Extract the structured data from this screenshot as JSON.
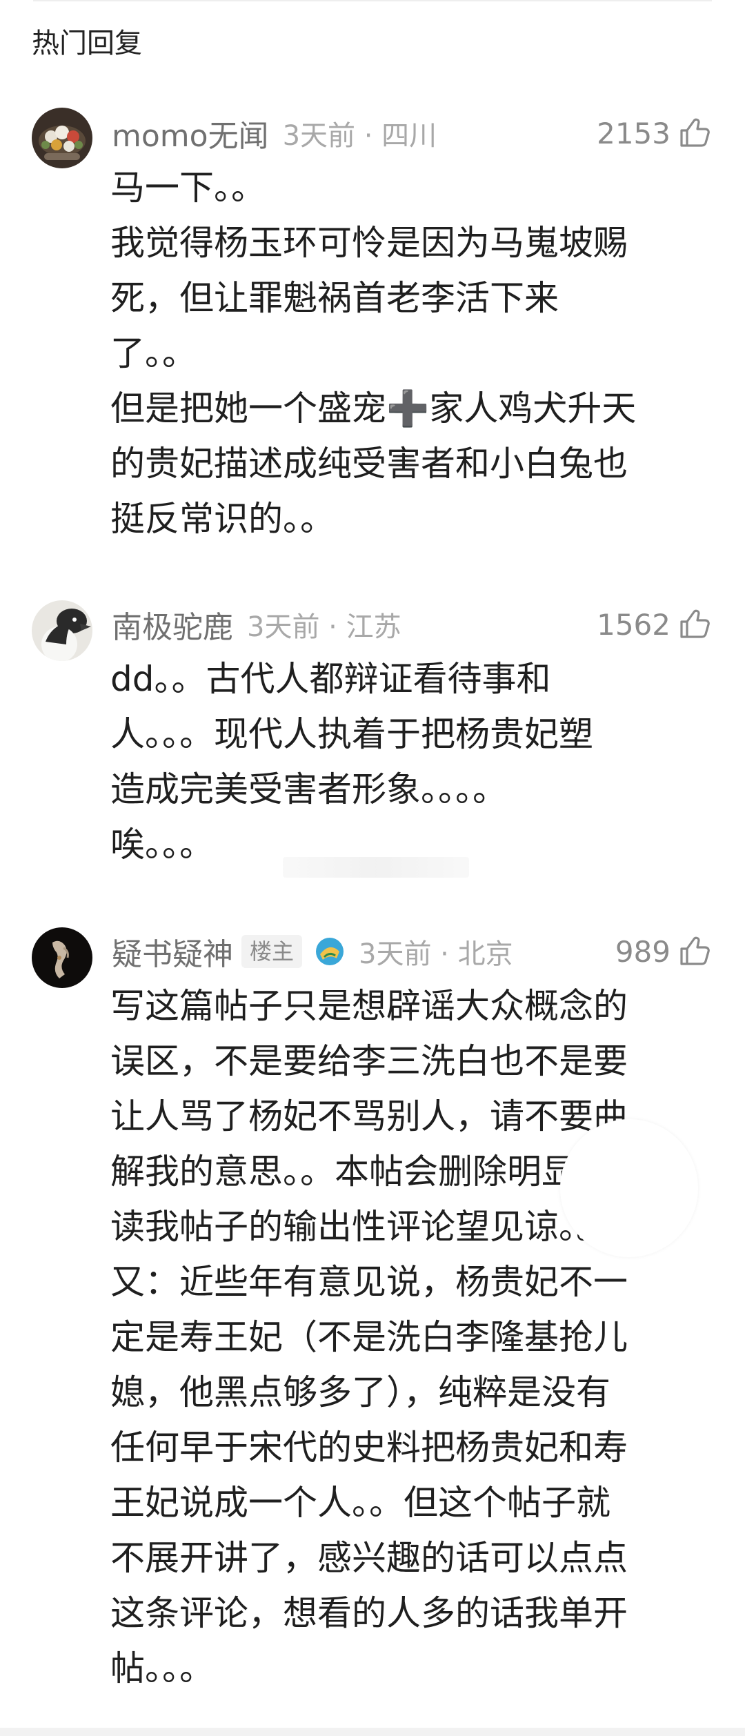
{
  "section": {
    "title": "热门回复"
  },
  "comments": [
    {
      "username": "momo无闻",
      "badge": "",
      "time": "3天前 · 四川",
      "likes": "2153",
      "lines": [
        "马一下。。",
        "我觉得杨玉环可怜是因为马嵬坡赐",
        "死，但让罪魁祸首老李活下来",
        "了。。",
        "但是把她一个盛宠➕家人鸡犬升天",
        "的贵妃描述成纯受害者和小白兔也",
        "挺反常识的。。"
      ]
    },
    {
      "username": "南极驼鹿",
      "badge": "",
      "time": "3天前 · 江苏",
      "likes": "1562",
      "lines": [
        "dd。。古代人都辩证看待事和",
        "人。。。现代人执着于把杨贵妃塑",
        "造成完美受害者形象。。。。",
        "唉。。。"
      ]
    },
    {
      "username": "疑书疑神",
      "badge": "楼主",
      "time": "3天前 · 北京",
      "likes": "989",
      "lines": [
        "写这篇帖子只是想辟谣大众概念的",
        "误区，不是要给李三洗白也不是要",
        "让人骂了杨妃不骂别人，请不要曲",
        "解我的意思。。本帖会删除明显没",
        "读我帖子的输出性评论望见谅。。",
        "又：近些年有意见说，杨贵妃不一",
        "定是寿王妃（不是洗白李隆基抢儿",
        "媳，他黑点够多了），纯粹是没有",
        "任何早于宋代的史料把杨贵妃和寿",
        "王妃说成一个人。。但这个帖子就",
        "不展开讲了，感兴趣的话可以点点",
        "这条评论，想看的人多的话我单开",
        "帖。。。"
      ]
    }
  ],
  "colors": {
    "username": "#707070",
    "time": "#a8a8a8",
    "body_text": "#1f1f1f"
  },
  "icons": [
    "avatar-flower-bouquet",
    "avatar-penguin",
    "avatar-hand",
    "level-icon",
    "thumbs-up-icon"
  ]
}
